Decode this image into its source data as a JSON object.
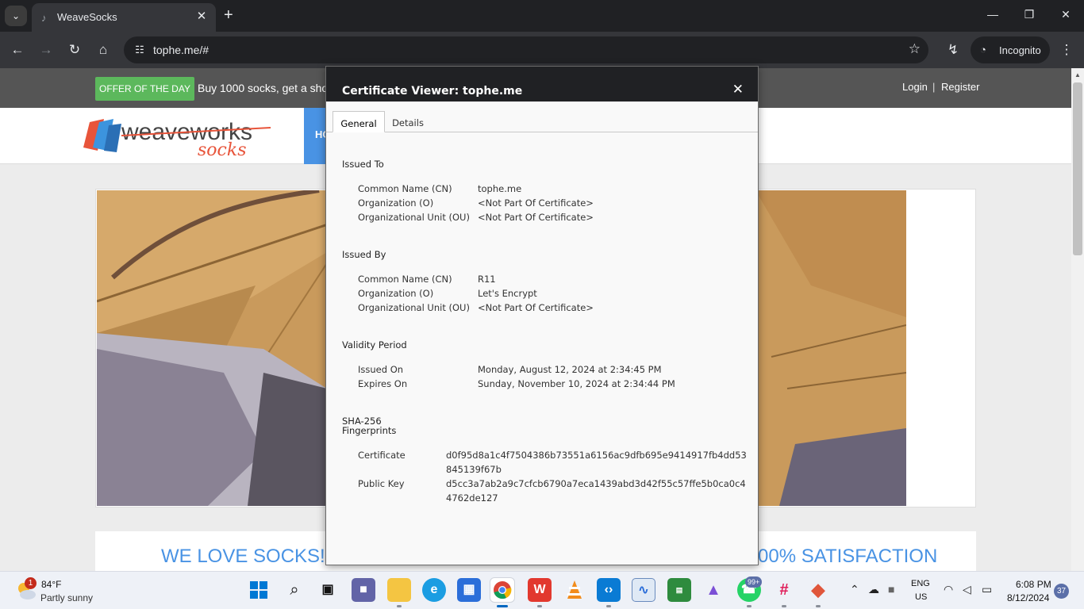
{
  "browser": {
    "tab_title": "WeaveSocks",
    "url": "tophe.me/#",
    "incognito_label": "Incognito"
  },
  "site": {
    "offer_badge": "OFFER OF THE DAY",
    "offer_text": "Buy 1000 socks, get a sho",
    "login": "Login",
    "separator": "|",
    "register": "Register",
    "logo_alt": "weaveworks socks",
    "nav_home": "HO",
    "feature_left": "WE LOVE SOCKS!",
    "feature_right": "00% SATISFACTION",
    "carousel_active_index": 3,
    "colors": {
      "accent": "#4993e4",
      "offer_green": "#5cb85c",
      "topbar": "#555555"
    }
  },
  "certificate": {
    "title": "Certificate Viewer: tophe.me",
    "tabs": [
      "General",
      "Details"
    ],
    "active_tab": "General",
    "issued_to": {
      "heading": "Issued To",
      "cn_label": "Common Name (CN)",
      "cn": "tophe.me",
      "o_label": "Organization (O)",
      "o": "<Not Part Of Certificate>",
      "ou_label": "Organizational Unit (OU)",
      "ou": "<Not Part Of Certificate>"
    },
    "issued_by": {
      "heading": "Issued By",
      "cn_label": "Common Name (CN)",
      "cn": "R11",
      "o_label": "Organization (O)",
      "o": "Let's Encrypt",
      "ou_label": "Organizational Unit (OU)",
      "ou": "<Not Part Of Certificate>"
    },
    "validity": {
      "heading": "Validity Period",
      "issued_on_label": "Issued On",
      "issued_on": "Monday, August 12, 2024 at 2:34:45 PM",
      "expires_on_label": "Expires On",
      "expires_on": "Sunday, November 10, 2024 at 2:34:44 PM"
    },
    "fingerprints": {
      "heading_line1": "SHA-256",
      "heading_line2": "Fingerprints",
      "certificate_label": "Certificate",
      "certificate": "d0f95d8a1c4f7504386b73551a6156ac9dfb695e9414917fb4dd53845139f67b",
      "public_key_label": "Public Key",
      "public_key": "d5cc3a7ab2a9c7cfcb6790a7eca1439abd3d42f55c57ffe5b0ca0c44762de127"
    }
  },
  "taskbar": {
    "weather_badge": "1",
    "weather_temp": "84°F",
    "weather_desc": "Partly sunny",
    "whatsapp_badge": "99+",
    "lang_line1": "ENG",
    "lang_line2": "US",
    "time": "6:08 PM",
    "date": "8/12/2024",
    "notifications": "37"
  }
}
